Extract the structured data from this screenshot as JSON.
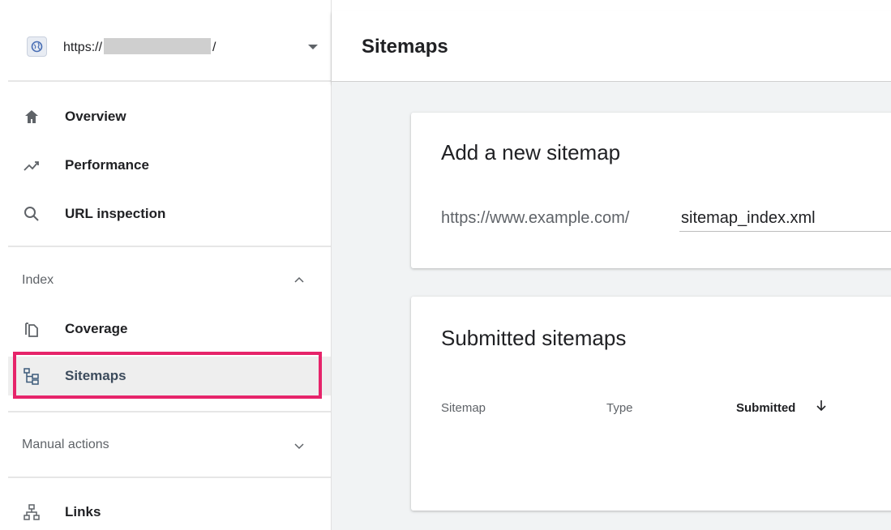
{
  "property": {
    "url_prefix": "https://",
    "url_suffix": "/"
  },
  "nav": {
    "overview": "Overview",
    "performance": "Performance",
    "url_inspection": "URL inspection",
    "index_section": "Index",
    "coverage": "Coverage",
    "sitemaps": "Sitemaps",
    "manual_actions_section": "Manual actions",
    "links": "Links"
  },
  "header": {
    "title": "Sitemaps"
  },
  "add_card": {
    "title": "Add a new sitemap",
    "url_prefix": "https://www.example.com/",
    "input_value": "sitemap_index.xml"
  },
  "submitted_card": {
    "title": "Submitted sitemaps",
    "columns": [
      "Sitemap",
      "Type",
      "Submitted"
    ]
  },
  "colors": {
    "highlight": "#e6246a",
    "active_bg": "#eeeeee",
    "main_bg": "#f1f3f4"
  }
}
